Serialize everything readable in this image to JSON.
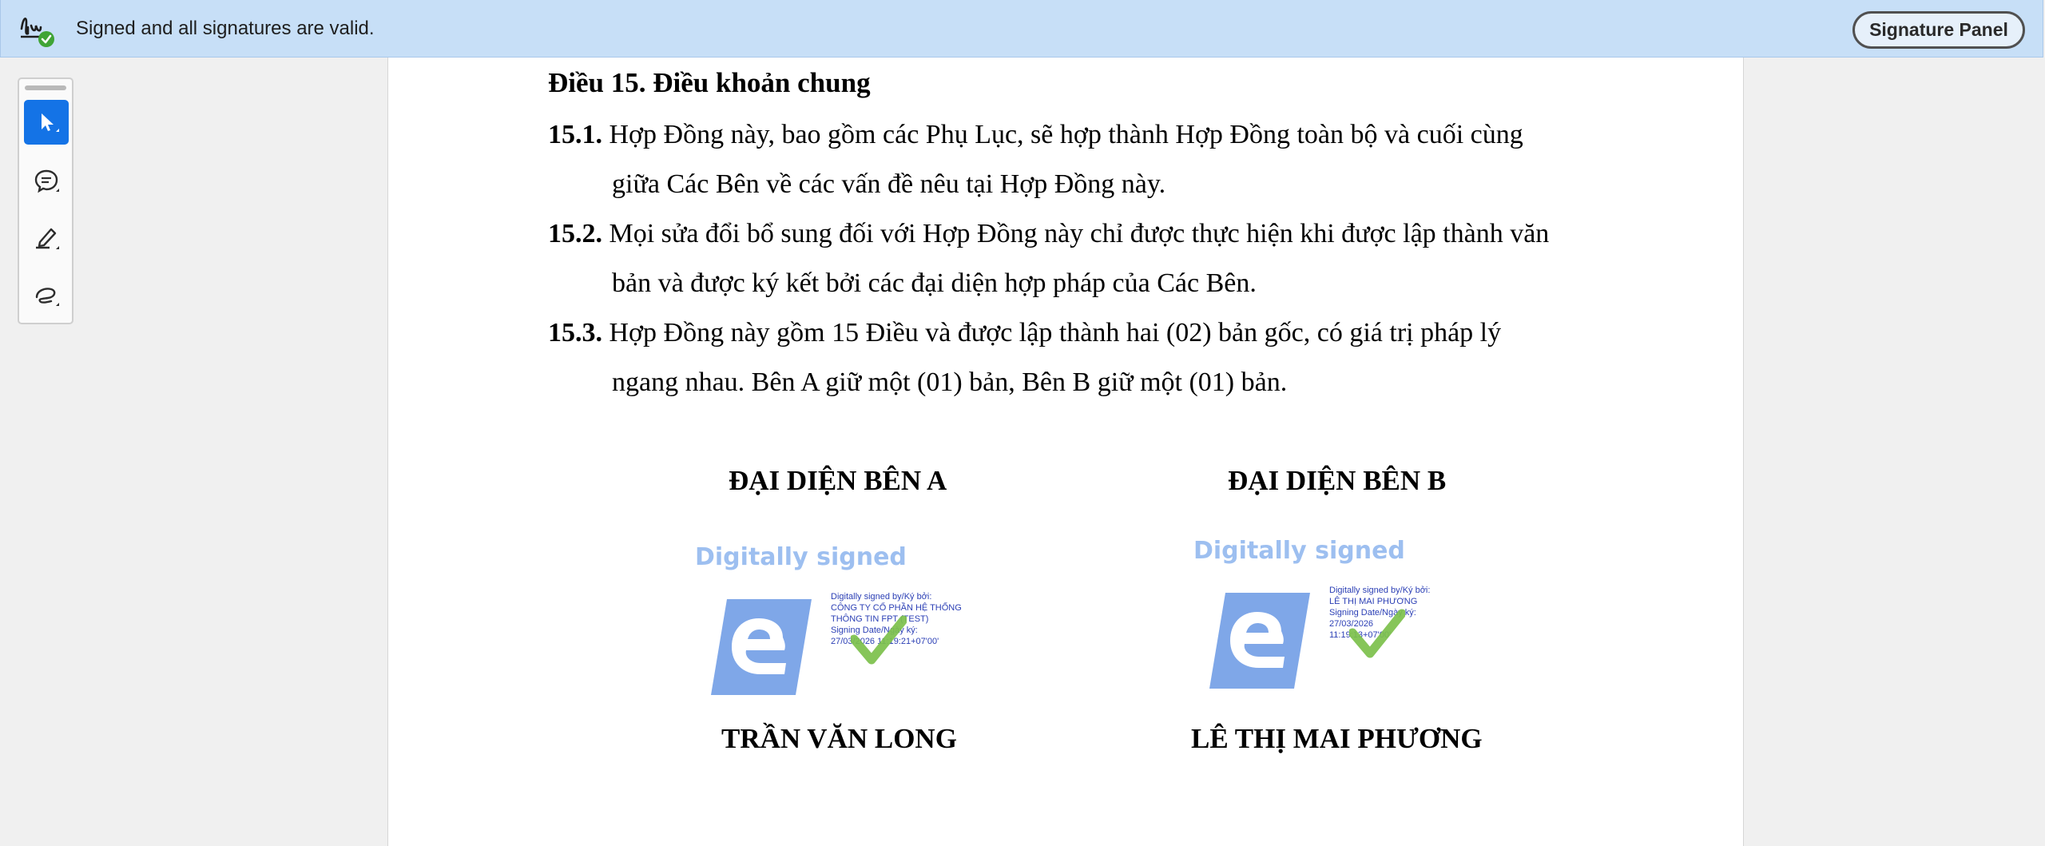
{
  "signature_bar": {
    "status_text": "Signed and all signatures are valid.",
    "signature_panel_label": "Signature Panel"
  },
  "toolbar": {
    "tools": [
      {
        "name": "select-tool",
        "icon": "cursor-arrow-icon",
        "active": true
      },
      {
        "name": "comment-tool",
        "icon": "comment-bubble-icon",
        "active": false
      },
      {
        "name": "highlight-tool",
        "icon": "highlighter-pen-icon",
        "active": false
      },
      {
        "name": "draw-tool",
        "icon": "freehand-loop-icon",
        "active": false
      }
    ]
  },
  "document": {
    "heading": "Điều 15. Điều khoản chung",
    "clauses": [
      {
        "number": "15.1.",
        "line1": "Hợp Đồng này, bao gồm các Phụ Lục, sẽ hợp thành Hợp Đồng toàn bộ và cuối cùng",
        "line2": "giữa Các Bên về các vấn đề nêu tại Hợp Đồng này."
      },
      {
        "number": "15.2.",
        "line1": "Mọi sửa đổi bổ sung đối với Hợp Đồng này chỉ được thực hiện khi được lập thành văn",
        "line2": "bản và được ký kết bởi các đại diện hợp pháp của Các Bên."
      },
      {
        "number": "15.3.",
        "line1": "Hợp Đồng này gồm 15 Điều và được lập thành hai (02) bản gốc, có giá trị pháp lý",
        "line2": "ngang nhau. Bên A giữ một (01) bản, Bên B giữ một (01) bản."
      }
    ],
    "party_a": {
      "title": "ĐẠI DIỆN BÊN A",
      "digitally_signed": "Digitally signed",
      "details": [
        "Digitally signed by/Ký bởi:",
        "CÔNG TY CỔ PHẦN HỆ THỐNG",
        "THÔNG TIN FPT (TEST)",
        "Signing Date/Ngày ký:",
        "27/03/2026 11:19:21+07'00'"
      ],
      "signer": "TRẦN VĂN LONG"
    },
    "party_b": {
      "title": "ĐẠI DIỆN BÊN B",
      "digitally_signed": "Digitally signed",
      "details": [
        "Digitally signed by/Ký bởi:",
        "LÊ THỊ MAI PHƯƠNG",
        "Signing Date/Ngày ký:",
        "27/03/2026",
        "11:19:13+07'00'"
      ],
      "signer": "LÊ THỊ MAI PHƯƠNG"
    }
  },
  "colors": {
    "signature_bar_bg": "#c7dff7",
    "active_tool": "#1473e6",
    "stamp_blue": "#9dbff0",
    "check_green": "#7cc04b"
  }
}
